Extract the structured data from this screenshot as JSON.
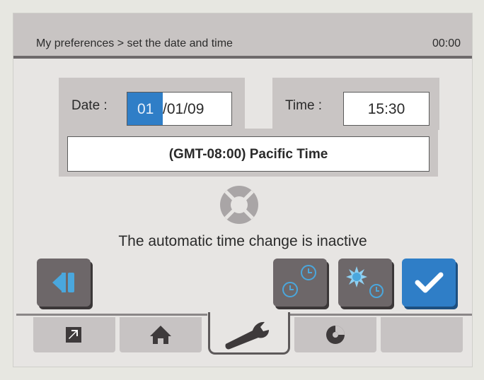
{
  "header": {
    "breadcrumb": "My preferences > set the date and time",
    "clock": "00:00"
  },
  "date": {
    "label": "Date :",
    "selected_part": "01",
    "rest": "/01/09"
  },
  "time": {
    "label": "Time :",
    "value": "15:30"
  },
  "timezone": {
    "value": "(GMT-08:00) Pacific Time"
  },
  "status": {
    "message": "The automatic time change is inactive"
  },
  "buttons": {
    "back": {
      "icon": "back-icon"
    },
    "clock_settings": {
      "icon": "clock-pair-icon"
    },
    "dst_settings": {
      "icon": "sun-clock-icon"
    },
    "confirm": {
      "icon": "check-icon"
    }
  },
  "tabs": [
    {
      "icon": "shortcut-arrow-icon",
      "active": false
    },
    {
      "icon": "home-icon",
      "active": false
    },
    {
      "icon": "wrench-icon",
      "active": true
    },
    {
      "icon": "disc-icon",
      "active": false
    },
    {
      "icon": "",
      "active": false
    }
  ],
  "colors": {
    "accent": "#2f7ec7",
    "button_grey": "#6d6769",
    "panel": "#c9c5c4",
    "background": "#e7e5e3"
  }
}
